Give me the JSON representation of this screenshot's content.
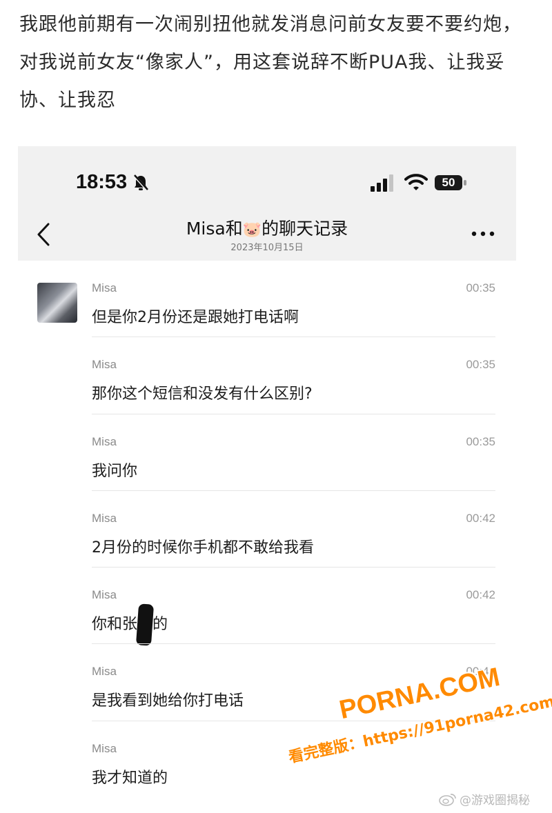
{
  "post": {
    "text": "我跟他前期有一次闹别扭他就发消息问前女友要不要约炮，对我说前女友“像家人”，用这套说辞不断PUA我、让我妥协、让我忍"
  },
  "status_bar": {
    "time": "18:53",
    "battery": "50"
  },
  "nav": {
    "title_prefix": "Misa和",
    "title_emoji": "🐷",
    "title_suffix": "的聊天记录",
    "date": "2023年10月15日"
  },
  "messages": [
    {
      "sender": "Misa",
      "time": "00:35",
      "text": "但是你2月份还是跟她打电话啊"
    },
    {
      "sender": "Misa",
      "time": "00:35",
      "text": "那你这个短信和没发有什么区别?"
    },
    {
      "sender": "Misa",
      "time": "00:35",
      "text": "我问你"
    },
    {
      "sender": "Misa",
      "time": "00:42",
      "text": "2月份的时候你手机都不敢给我看"
    },
    {
      "sender": "Misa",
      "time": "00:42",
      "text_before": "你和张",
      "text_after": "的"
    },
    {
      "sender": "Misa",
      "time": "00:42",
      "text": "是我看到她给你打电话"
    },
    {
      "sender": "Misa",
      "text": "我才知道的"
    }
  ],
  "watermark": {
    "main": "PORNA.COM",
    "url": "看完整版：https://91porna42.com"
  },
  "weibo": {
    "handle": "@游戏圈揭秘"
  }
}
